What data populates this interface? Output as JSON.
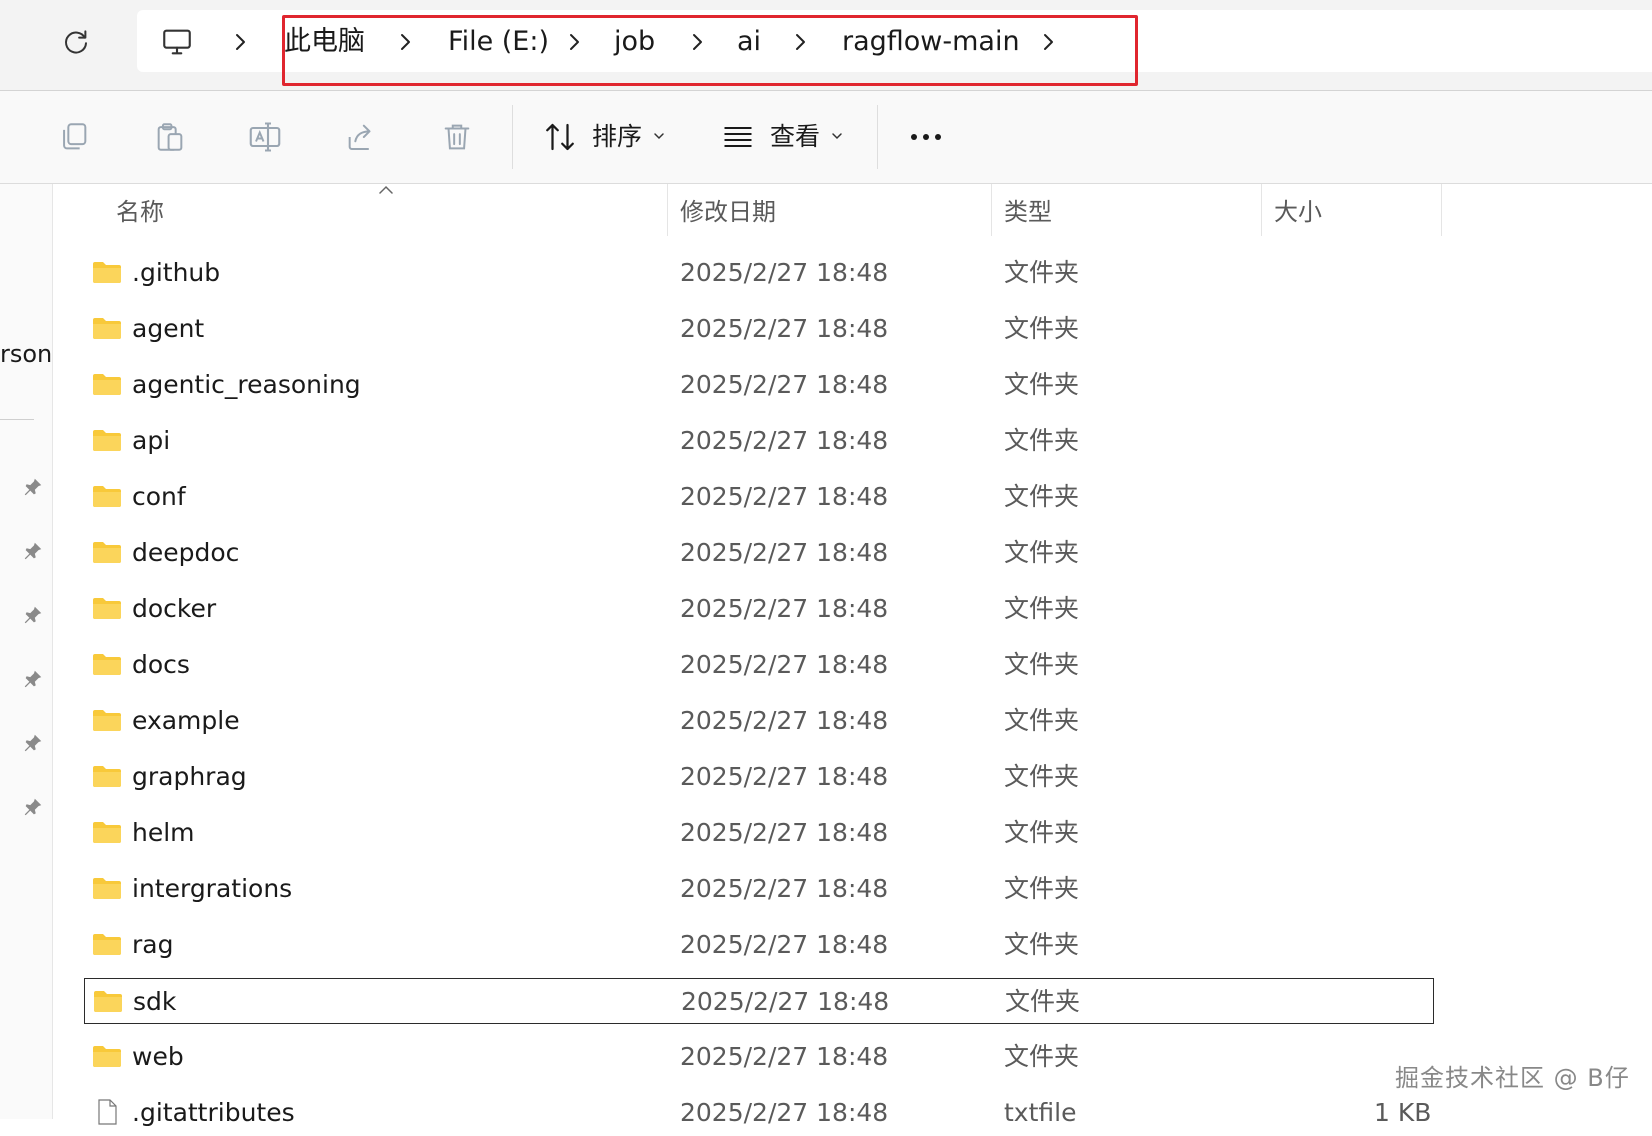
{
  "breadcrumb": {
    "items": [
      "此电脑",
      "File (E:)",
      "job",
      "ai",
      "ragflow-main"
    ]
  },
  "toolbar": {
    "sort_label": "排序",
    "view_label": "查看"
  },
  "nav": {
    "partial_label": "rson"
  },
  "columns": {
    "name": "名称",
    "date": "修改日期",
    "type": "类型",
    "size": "大小"
  },
  "files": [
    {
      "name": ".github",
      "date": "2025/2/27 18:48",
      "type": "文件夹",
      "size": "",
      "kind": "folder"
    },
    {
      "name": "agent",
      "date": "2025/2/27 18:48",
      "type": "文件夹",
      "size": "",
      "kind": "folder"
    },
    {
      "name": "agentic_reasoning",
      "date": "2025/2/27 18:48",
      "type": "文件夹",
      "size": "",
      "kind": "folder"
    },
    {
      "name": "api",
      "date": "2025/2/27 18:48",
      "type": "文件夹",
      "size": "",
      "kind": "folder"
    },
    {
      "name": "conf",
      "date": "2025/2/27 18:48",
      "type": "文件夹",
      "size": "",
      "kind": "folder"
    },
    {
      "name": "deepdoc",
      "date": "2025/2/27 18:48",
      "type": "文件夹",
      "size": "",
      "kind": "folder"
    },
    {
      "name": "docker",
      "date": "2025/2/27 18:48",
      "type": "文件夹",
      "size": "",
      "kind": "folder"
    },
    {
      "name": "docs",
      "date": "2025/2/27 18:48",
      "type": "文件夹",
      "size": "",
      "kind": "folder"
    },
    {
      "name": "example",
      "date": "2025/2/27 18:48",
      "type": "文件夹",
      "size": "",
      "kind": "folder"
    },
    {
      "name": "graphrag",
      "date": "2025/2/27 18:48",
      "type": "文件夹",
      "size": "",
      "kind": "folder"
    },
    {
      "name": "helm",
      "date": "2025/2/27 18:48",
      "type": "文件夹",
      "size": "",
      "kind": "folder"
    },
    {
      "name": "intergrations",
      "date": "2025/2/27 18:48",
      "type": "文件夹",
      "size": "",
      "kind": "folder"
    },
    {
      "name": "rag",
      "date": "2025/2/27 18:48",
      "type": "文件夹",
      "size": "",
      "kind": "folder"
    },
    {
      "name": "sdk",
      "date": "2025/2/27 18:48",
      "type": "文件夹",
      "size": "",
      "kind": "folder",
      "selected": true
    },
    {
      "name": "web",
      "date": "2025/2/27 18:48",
      "type": "文件夹",
      "size": "",
      "kind": "folder"
    },
    {
      "name": ".gitattributes",
      "date": "2025/2/27 18:48",
      "type": "txtfile",
      "size": "1 KB",
      "kind": "file"
    }
  ],
  "watermark": "掘金技术社区 @ B仔",
  "icons": {
    "folder_color": "#f8c93a",
    "highlight_color": "#e0262f"
  }
}
